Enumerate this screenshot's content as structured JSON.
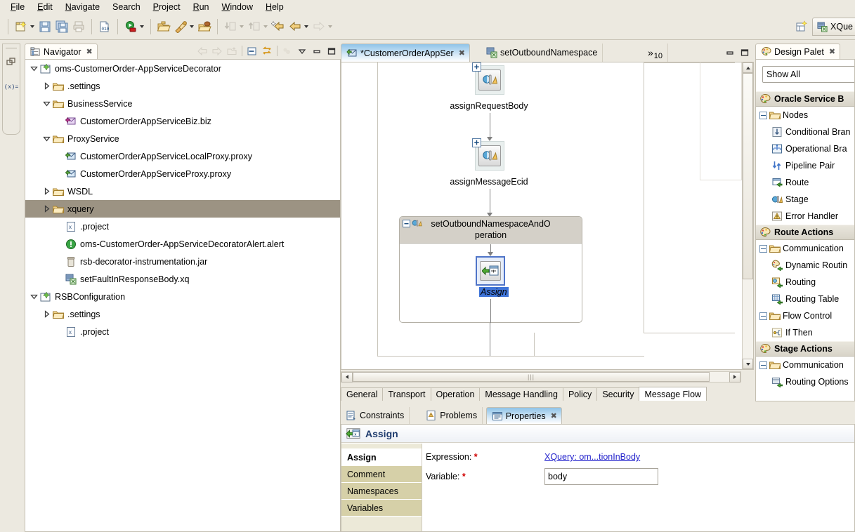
{
  "menu": {
    "items": [
      {
        "label": "File",
        "mnemonic": "F"
      },
      {
        "label": "Edit",
        "mnemonic": "E"
      },
      {
        "label": "Navigate",
        "mnemonic": "N"
      },
      {
        "label": "Search",
        "mnemonic": "S"
      },
      {
        "label": "Project",
        "mnemonic": "P"
      },
      {
        "label": "Run",
        "mnemonic": "R"
      },
      {
        "label": "Window",
        "mnemonic": "W"
      },
      {
        "label": "Help",
        "mnemonic": "H"
      }
    ]
  },
  "toolbar": {
    "buttons": [
      {
        "name": "new-wizard-icon",
        "tooltip": "New"
      },
      {
        "name": "save-icon",
        "tooltip": "Save"
      },
      {
        "name": "save-all-icon",
        "tooltip": "Save All"
      },
      {
        "name": "print-icon",
        "tooltip": "Print"
      },
      {
        "name": "binary-file-icon",
        "tooltip": "New Untitled Text File"
      },
      {
        "name": "run-icon",
        "tooltip": "Run"
      },
      {
        "name": "open-resource-icon",
        "tooltip": "Open Resource"
      },
      {
        "name": "build-icon",
        "tooltip": "Build"
      },
      {
        "name": "import-project-icon",
        "tooltip": "Import Project"
      },
      {
        "name": "download-icon",
        "tooltip": "Get Resources"
      },
      {
        "name": "upload-icon",
        "tooltip": "Publish Resources"
      },
      {
        "name": "back-new-icon",
        "tooltip": "Last Edit Location"
      },
      {
        "name": "back-icon",
        "tooltip": "Back"
      },
      {
        "name": "forward-icon",
        "tooltip": "Forward"
      }
    ]
  },
  "perspective": {
    "open_perspective_icon": "open-perspective-icon",
    "active_label": "XQue"
  },
  "fastview": {
    "icons": [
      "restore-icon",
      "variables-icon"
    ]
  },
  "navigator": {
    "tab_label": "Navigator",
    "close_icon": "close-icon",
    "toolbar_icons": [
      "back-icon",
      "forward-icon",
      "up-icon",
      "collapse-all-icon",
      "link-with-editor-icon",
      "filter-icon",
      "view-menu-icon",
      "minimize-icon",
      "maximize-icon"
    ],
    "tree": [
      {
        "label": "oms-CustomerOrder-AppServiceDecorator",
        "depth": 0,
        "twist": "expanded",
        "icon": "project-icon",
        "selected": false
      },
      {
        "label": ".settings",
        "depth": 1,
        "twist": "collapsed",
        "icon": "folder-icon",
        "selected": false
      },
      {
        "label": "BusinessService",
        "depth": 1,
        "twist": "expanded",
        "icon": "folder-icon",
        "selected": false
      },
      {
        "label": "CustomerOrderAppServiceBiz.biz",
        "depth": 2,
        "twist": "none",
        "icon": "biz-service-icon",
        "selected": false
      },
      {
        "label": "ProxyService",
        "depth": 1,
        "twist": "expanded",
        "icon": "folder-icon",
        "selected": false
      },
      {
        "label": "CustomerOrderAppServiceLocalProxy.proxy",
        "depth": 2,
        "twist": "none",
        "icon": "proxy-service-icon",
        "selected": false
      },
      {
        "label": "CustomerOrderAppServiceProxy.proxy",
        "depth": 2,
        "twist": "none",
        "icon": "proxy-service-icon",
        "selected": false
      },
      {
        "label": "WSDL",
        "depth": 1,
        "twist": "collapsed",
        "icon": "folder-icon",
        "selected": false
      },
      {
        "label": "xquery",
        "depth": 1,
        "twist": "collapsed",
        "icon": "folder-icon",
        "selected": true
      },
      {
        "label": ".project",
        "depth": 2,
        "twist": "none",
        "icon": "xml-file-icon",
        "selected": false
      },
      {
        "label": "oms-CustomerOrder-AppServiceDecoratorAlert.alert",
        "depth": 2,
        "twist": "none",
        "icon": "alert-icon",
        "selected": false
      },
      {
        "label": "rsb-decorator-instrumentation.jar",
        "depth": 2,
        "twist": "none",
        "icon": "jar-icon",
        "selected": false
      },
      {
        "label": "setFaultInResponseBody.xq",
        "depth": 2,
        "twist": "none",
        "icon": "xquery-file-icon",
        "selected": false
      },
      {
        "label": "RSBConfiguration",
        "depth": 0,
        "twist": "expanded",
        "icon": "project-icon",
        "selected": false
      },
      {
        "label": ".settings",
        "depth": 1,
        "twist": "collapsed",
        "icon": "folder-icon",
        "selected": false
      },
      {
        "label": ".project",
        "depth": 2,
        "twist": "none",
        "icon": "xml-file-icon",
        "selected": false
      }
    ]
  },
  "editor": {
    "tabs": [
      {
        "label": "*CustomerOrderAppSer",
        "icon": "proxy-service-icon",
        "active": true,
        "closable": true
      },
      {
        "label": "setOutboundNamespace",
        "icon": "xquery-file-icon",
        "active": false,
        "closable": false
      }
    ],
    "overflow_chevron": "»",
    "overflow_count": "10",
    "minimize_icon": "minimize-icon",
    "maximize_icon": "maximize-icon",
    "diagram": {
      "nodes": [
        {
          "id": "assignRequestBody",
          "label": "assignRequestBody",
          "type": "stage",
          "expandable": true
        },
        {
          "id": "assignMessageEcid",
          "label": "assignMessageEcid",
          "type": "stage",
          "expandable": true
        }
      ],
      "stage_container": {
        "label": "setOutboundNamespaceAndOperation",
        "label_line1": "setOutboundNamespaceAndO",
        "label_line2": "peration",
        "collapse_icon": "minus-icon",
        "icon": "stage-icon",
        "child": {
          "label": "Assign",
          "icon": "assign-icon",
          "selected": true
        }
      }
    },
    "bottom_tabs": [
      {
        "label": "General",
        "active": false
      },
      {
        "label": "Transport",
        "active": false
      },
      {
        "label": "Operation",
        "active": false
      },
      {
        "label": "Message Handling",
        "active": false
      },
      {
        "label": "Policy",
        "active": false
      },
      {
        "label": "Security",
        "active": false
      },
      {
        "label": "Message Flow",
        "active": true
      }
    ]
  },
  "properties": {
    "tabs": [
      {
        "label": "Constraints",
        "icon": "constraints-icon",
        "active": false,
        "closable": false
      },
      {
        "label": "Problems",
        "icon": "problems-icon",
        "active": false,
        "closable": false
      },
      {
        "label": "Properties",
        "icon": "properties-icon",
        "active": true,
        "closable": true
      }
    ],
    "restore_icon": "restore-view-icon",
    "title": "Assign",
    "title_icon": "assign-icon",
    "left_tabs": [
      {
        "label": "Assign",
        "active": true
      },
      {
        "label": "Comment",
        "active": false
      },
      {
        "label": "Namespaces",
        "active": false
      },
      {
        "label": "Variables",
        "active": false
      }
    ],
    "fields": [
      {
        "label": "Expression:",
        "required": true,
        "type": "link",
        "value": "XQuery: om...tionInBody"
      },
      {
        "label": "Variable:",
        "required": true,
        "type": "text",
        "value": "body"
      }
    ]
  },
  "palette": {
    "tab_label": "Design Palet",
    "close_icon": "close-icon",
    "filter_value": "Show All",
    "sections": [
      {
        "title": "Oracle Service B",
        "icon": "palette-icon",
        "folders": [
          {
            "label": "Nodes",
            "items": [
              {
                "label": "Conditional Bran",
                "icon": "conditional-branch-icon"
              },
              {
                "label": "Operational Bra",
                "icon": "operational-branch-icon"
              },
              {
                "label": "Pipeline Pair",
                "icon": "pipeline-pair-icon"
              },
              {
                "label": "Route",
                "icon": "route-icon"
              },
              {
                "label": "Stage",
                "icon": "stage-icon"
              },
              {
                "label": "Error Handler",
                "icon": "error-handler-icon"
              }
            ]
          }
        ]
      },
      {
        "title": "Route Actions",
        "icon": "palette-icon",
        "folders": [
          {
            "label": "Communication",
            "items": [
              {
                "label": "Dynamic Routin",
                "icon": "dynamic-routing-icon"
              },
              {
                "label": "Routing",
                "icon": "routing-icon"
              },
              {
                "label": "Routing Table",
                "icon": "routing-table-icon"
              }
            ]
          },
          {
            "label": "Flow Control",
            "items": [
              {
                "label": "If Then",
                "icon": "if-then-icon"
              }
            ]
          }
        ]
      },
      {
        "title": "Stage Actions",
        "icon": "palette-icon",
        "folders": [
          {
            "label": "Communication",
            "items": [
              {
                "label": "Routing Options",
                "icon": "routing-options-icon"
              }
            ]
          }
        ]
      }
    ]
  },
  "colors": {
    "selection_blue": "#3f74d8",
    "tree_selection": "#9c9383",
    "active_tab": "#8fc4e8",
    "link": "#2222cc",
    "required": "#d00000",
    "panel_bg": "#ece9e0",
    "title_text": "#1f3c6e"
  }
}
